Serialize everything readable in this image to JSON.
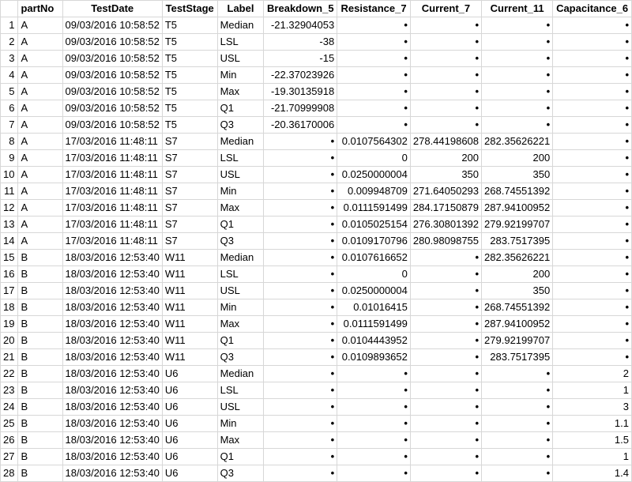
{
  "columns": [
    "partNo",
    "TestDate",
    "TestStage",
    "Label",
    "Breakdown_5",
    "Resistance_7",
    "Current_7",
    "Current_11",
    "Capacitance_6"
  ],
  "column_align": [
    "txt",
    "txt",
    "txt",
    "txt",
    "num",
    "num",
    "num",
    "num",
    "num"
  ],
  "missing_symbol": "•",
  "rows": [
    [
      "A",
      "09/03/2016 10:58:52",
      "T5",
      "Median",
      "-21.32904053",
      "•",
      "•",
      "•",
      "•"
    ],
    [
      "A",
      "09/03/2016 10:58:52",
      "T5",
      "LSL",
      "-38",
      "•",
      "•",
      "•",
      "•"
    ],
    [
      "A",
      "09/03/2016 10:58:52",
      "T5",
      "USL",
      "-15",
      "•",
      "•",
      "•",
      "•"
    ],
    [
      "A",
      "09/03/2016 10:58:52",
      "T5",
      "Min",
      "-22.37023926",
      "•",
      "•",
      "•",
      "•"
    ],
    [
      "A",
      "09/03/2016 10:58:52",
      "T5",
      "Max",
      "-19.30135918",
      "•",
      "•",
      "•",
      "•"
    ],
    [
      "A",
      "09/03/2016 10:58:52",
      "T5",
      "Q1",
      "-21.70999908",
      "•",
      "•",
      "•",
      "•"
    ],
    [
      "A",
      "09/03/2016 10:58:52",
      "T5",
      "Q3",
      "-20.36170006",
      "•",
      "•",
      "•",
      "•"
    ],
    [
      "A",
      "17/03/2016 11:48:11",
      "S7",
      "Median",
      "•",
      "0.0107564302",
      "278.44198608",
      "282.35626221",
      "•"
    ],
    [
      "A",
      "17/03/2016 11:48:11",
      "S7",
      "LSL",
      "•",
      "0",
      "200",
      "200",
      "•"
    ],
    [
      "A",
      "17/03/2016 11:48:11",
      "S7",
      "USL",
      "•",
      "0.0250000004",
      "350",
      "350",
      "•"
    ],
    [
      "A",
      "17/03/2016 11:48:11",
      "S7",
      "Min",
      "•",
      "0.009948709",
      "271.64050293",
      "268.74551392",
      "•"
    ],
    [
      "A",
      "17/03/2016 11:48:11",
      "S7",
      "Max",
      "•",
      "0.0111591499",
      "284.17150879",
      "287.94100952",
      "•"
    ],
    [
      "A",
      "17/03/2016 11:48:11",
      "S7",
      "Q1",
      "•",
      "0.0105025154",
      "276.30801392",
      "279.92199707",
      "•"
    ],
    [
      "A",
      "17/03/2016 11:48:11",
      "S7",
      "Q3",
      "•",
      "0.0109170796",
      "280.98098755",
      "283.7517395",
      "•"
    ],
    [
      "B",
      "18/03/2016 12:53:40",
      "W11",
      "Median",
      "•",
      "0.0107616652",
      "•",
      "282.35626221",
      "•"
    ],
    [
      "B",
      "18/03/2016 12:53:40",
      "W11",
      "LSL",
      "•",
      "0",
      "•",
      "200",
      "•"
    ],
    [
      "B",
      "18/03/2016 12:53:40",
      "W11",
      "USL",
      "•",
      "0.0250000004",
      "•",
      "350",
      "•"
    ],
    [
      "B",
      "18/03/2016 12:53:40",
      "W11",
      "Min",
      "•",
      "0.01016415",
      "•",
      "268.74551392",
      "•"
    ],
    [
      "B",
      "18/03/2016 12:53:40",
      "W11",
      "Max",
      "•",
      "0.0111591499",
      "•",
      "287.94100952",
      "•"
    ],
    [
      "B",
      "18/03/2016 12:53:40",
      "W11",
      "Q1",
      "•",
      "0.0104443952",
      "•",
      "279.92199707",
      "•"
    ],
    [
      "B",
      "18/03/2016 12:53:40",
      "W11",
      "Q3",
      "•",
      "0.0109893652",
      "•",
      "283.7517395",
      "•"
    ],
    [
      "B",
      "18/03/2016 12:53:40",
      "U6",
      "Median",
      "•",
      "•",
      "•",
      "•",
      "2"
    ],
    [
      "B",
      "18/03/2016 12:53:40",
      "U6",
      "LSL",
      "•",
      "•",
      "•",
      "•",
      "1"
    ],
    [
      "B",
      "18/03/2016 12:53:40",
      "U6",
      "USL",
      "•",
      "•",
      "•",
      "•",
      "3"
    ],
    [
      "B",
      "18/03/2016 12:53:40",
      "U6",
      "Min",
      "•",
      "•",
      "•",
      "•",
      "1.1"
    ],
    [
      "B",
      "18/03/2016 12:53:40",
      "U6",
      "Max",
      "•",
      "•",
      "•",
      "•",
      "1.5"
    ],
    [
      "B",
      "18/03/2016 12:53:40",
      "U6",
      "Q1",
      "•",
      "•",
      "•",
      "•",
      "1"
    ],
    [
      "B",
      "18/03/2016 12:53:40",
      "U6",
      "Q3",
      "•",
      "•",
      "•",
      "•",
      "1.4"
    ]
  ]
}
